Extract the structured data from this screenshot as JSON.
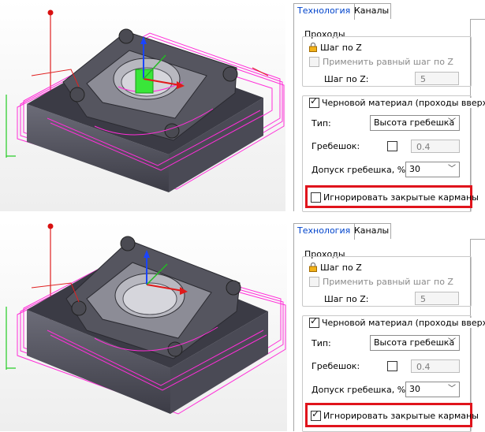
{
  "colors": {
    "toolpath": "#ff2ed8",
    "highlight_box": "#e0141c",
    "part_top": "#3d3d46",
    "part_side": "#5a5a66",
    "tab_active_text": "#0044cc"
  },
  "tabs": [
    {
      "label": "Технология",
      "active": true
    },
    {
      "label": "Каналы",
      "active": false
    }
  ],
  "top_panel": {
    "passes_group_label": "Проходы",
    "step_z_label": "Шаг по Z",
    "apply_equal_step_label": "Применить равный шаг по Z",
    "step_z_field_label": "Шаг по Z:",
    "step_z_value": "5",
    "rough_material_label": "Черновой материал (проходы вверх)",
    "rough_material_checked": true,
    "type_label": "Тип:",
    "type_value": "Высота гребешка",
    "scallop_label": "Гребешок:",
    "scallop_value": "0.4",
    "scallop_checked": false,
    "scallop_tol_label": "Допуск гребешка, %:",
    "scallop_tol_value": "30",
    "ignore_closed_label": "Игнорировать закрытые карманы",
    "ignore_closed_checked": false
  },
  "bottom_panel": {
    "passes_group_label": "Проходы",
    "step_z_label": "Шаг по Z",
    "apply_equal_step_label": "Применить равный шаг по Z",
    "step_z_field_label": "Шаг по Z:",
    "step_z_value": "5",
    "rough_material_label": "Черновой материал (проходы вверх)",
    "rough_material_checked": true,
    "type_label": "Тип:",
    "type_value": "Высота гребешка",
    "scallop_label": "Гребешок:",
    "scallop_value": "0.4",
    "scallop_checked": false,
    "scallop_tol_label": "Допуск гребешка, %:",
    "scallop_tol_value": "30",
    "ignore_closed_label": "Игнорировать закрытые карманы",
    "ignore_closed_checked": true
  },
  "icons": [
    "lock-icon",
    "chevron-down-icon",
    "tool-icon",
    "axis-triad-icon"
  ]
}
